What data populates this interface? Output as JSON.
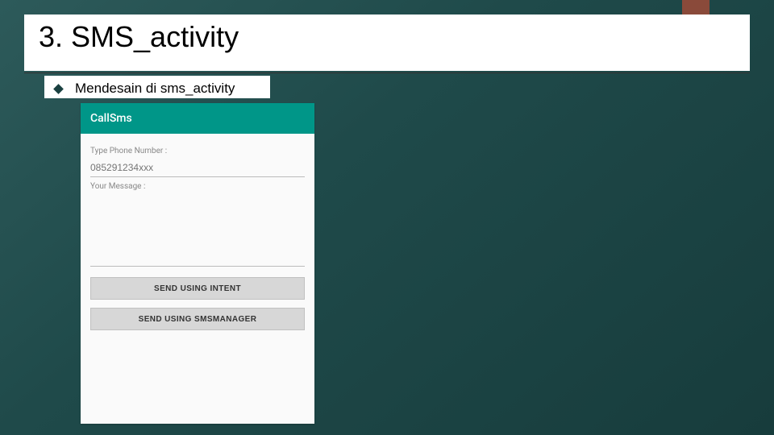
{
  "slide": {
    "title": "3. SMS_activity",
    "bullet": "Mendesain di sms_activity"
  },
  "phone": {
    "app_title": "CallSms",
    "phone_label": "Type Phone Number :",
    "phone_placeholder": "085291234xxx",
    "message_label": "Your Message :",
    "button_intent": "SEND USING INTENT",
    "button_manager": "SEND USING SMSMANAGER"
  }
}
